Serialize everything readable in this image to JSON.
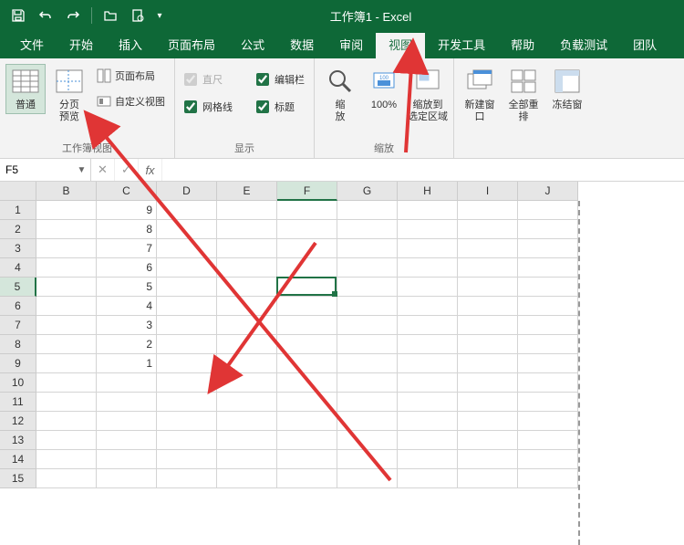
{
  "title": "工作簿1 - Excel",
  "tabs": [
    "文件",
    "开始",
    "插入",
    "页面布局",
    "公式",
    "数据",
    "审阅",
    "视图",
    "开发工具",
    "帮助",
    "负载测试",
    "团队"
  ],
  "active_tab": "视图",
  "ribbon": {
    "views_group_label": "工作簿视图",
    "normal": "普通",
    "page_break": "分页\n预览",
    "page_layout": "页面布局",
    "custom_views": "自定义视图",
    "show_group_label": "显示",
    "ruler": "直尺",
    "formula_bar": "编辑栏",
    "gridlines": "网格线",
    "headings": "标题",
    "zoom_group_label": "缩放",
    "zoom": "缩\n放",
    "zoom_100": "100%",
    "zoom_selection": "缩放到\n选定区域",
    "new_window": "新建窗口",
    "arrange_all": "全部重排",
    "freeze": "冻结窗"
  },
  "name_box": "F5",
  "columns": [
    "B",
    "C",
    "D",
    "E",
    "F",
    "G",
    "H",
    "I",
    "J"
  ],
  "rows": [
    1,
    2,
    3,
    4,
    5,
    6,
    7,
    8,
    9,
    10,
    11,
    12,
    13,
    14,
    15
  ],
  "cell_data": {
    "C": [
      9,
      8,
      7,
      6,
      5,
      4,
      3,
      2,
      1
    ]
  },
  "selected_cell": {
    "col": "F",
    "row": 5
  },
  "checks": {
    "ruler": true,
    "formula_bar": true,
    "gridlines": true,
    "headings": true
  }
}
